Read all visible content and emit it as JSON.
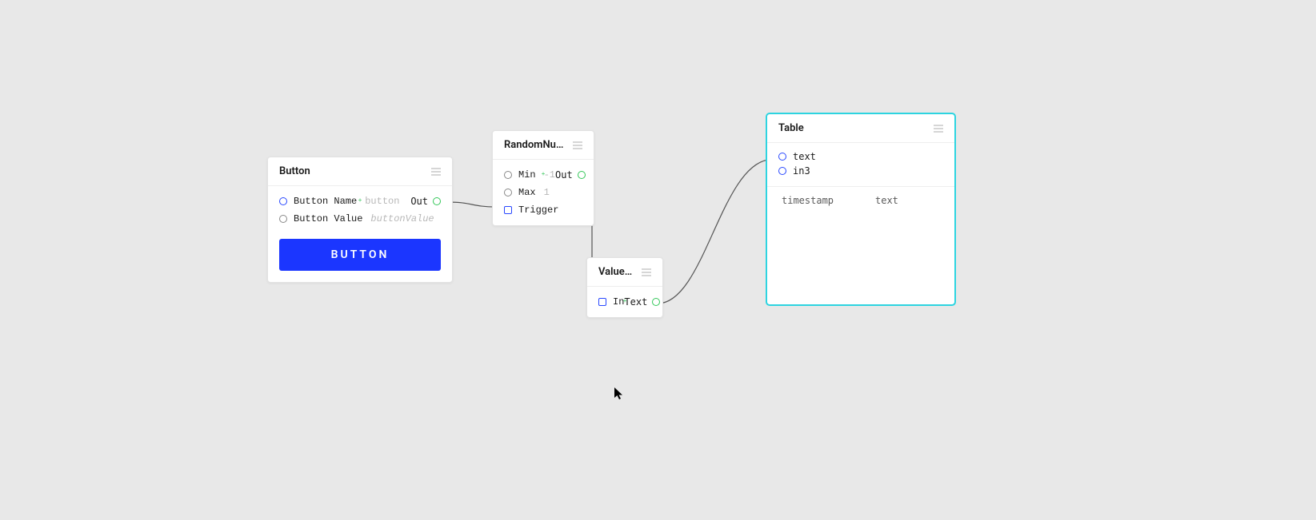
{
  "nodes": {
    "button": {
      "title": "Button",
      "rows": {
        "name": {
          "label": "Button Name",
          "value": "button"
        },
        "value": {
          "label": "Button Value",
          "value": "buttonValue"
        },
        "out": {
          "label": "Out"
        }
      },
      "action_label": "BUTTON"
    },
    "random": {
      "title": "RandomNum…",
      "rows": {
        "min": {
          "label": "Min",
          "value": "-1"
        },
        "max": {
          "label": "Max",
          "value": "1"
        },
        "trigger": {
          "label": "Trigger"
        },
        "out": {
          "label": "Out"
        }
      }
    },
    "value": {
      "title": "Value…",
      "rows": {
        "in": {
          "label": "In"
        },
        "text": {
          "label": "Text"
        }
      }
    },
    "table": {
      "title": "Table",
      "inputs": {
        "text": "text",
        "in3": "in3"
      },
      "columns": {
        "c0": "timestamp",
        "c1": "text"
      }
    }
  }
}
